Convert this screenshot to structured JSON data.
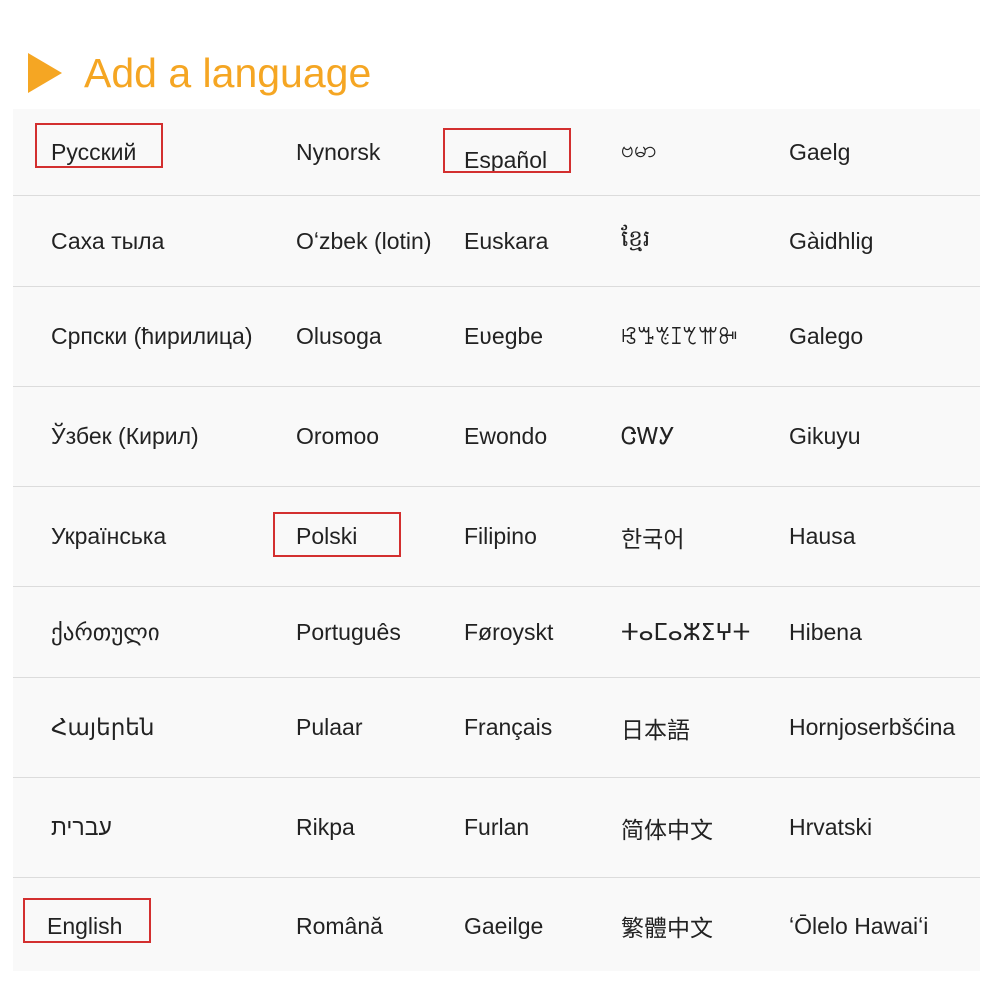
{
  "header": {
    "title": "Add a language"
  },
  "colors": {
    "accent": "#f5a623",
    "highlight": "#d32f2f"
  },
  "rows": [
    [
      "Русский",
      "Nynorsk",
      "Español",
      "ဗမာ",
      "Gaelg"
    ],
    [
      "Саха тыла",
      "Oʻzbek (lotin)",
      "Euskara",
      "ខ្មែរ",
      "Gàidhlig"
    ],
    [
      "Српски (ћирилица)",
      "Olusoga",
      "Eʋegbe",
      "ꕙꔤꔳꕯꕎꕌꔻ",
      "Galego"
    ],
    [
      "Ўзбек (Кирил)",
      "Oromoo",
      "Ewondo",
      "ᏣᎳᎩ",
      "Gikuyu"
    ],
    [
      "Українська",
      "Polski",
      "Filipino",
      "한국어",
      "Hausa"
    ],
    [
      "ქართული",
      "Português",
      "Føroyskt",
      "ⵜⴰⵎⴰⵣⵉⵖⵜ",
      "Hibena"
    ],
    [
      "Հայերեն",
      "Pulaar",
      "Français",
      "日本語",
      "Hornjoserbšćina"
    ],
    [
      "עברית",
      "Rikpa",
      "Furlan",
      "简体中文",
      "Hrvatski"
    ],
    [
      "English",
      "Română",
      "Gaeilge",
      "繁體中文",
      "ʻŌlelo Hawaiʻi"
    ]
  ],
  "highlighted": [
    "Русский",
    "Español",
    "Polski",
    "English"
  ]
}
